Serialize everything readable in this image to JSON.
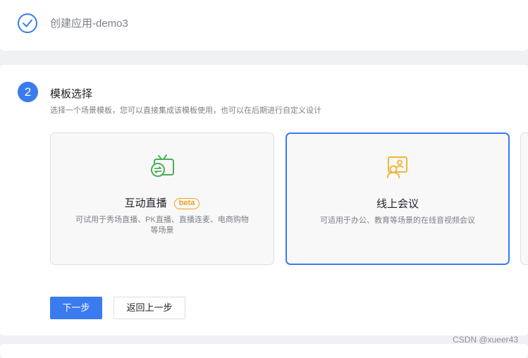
{
  "step1": {
    "status": "completed",
    "title": "创建应用-demo3",
    "icon": "check-icon"
  },
  "step2": {
    "number": "2",
    "title": "模板选择",
    "description": "选择一个场景模板，您可以直接集成该模板使用，也可以在后期进行自定义设计",
    "cards": [
      {
        "id": "live",
        "icon": "tv-live-icon",
        "title": "互动直播",
        "badge": "beta",
        "description": "可试用于秀场直播、PK直播、直播连麦、电商购物等场景",
        "selected": false
      },
      {
        "id": "meeting",
        "icon": "video-meeting-icon",
        "title": "线上会议",
        "description": "可适用于办公、教育等场景的在线音视频会议",
        "selected": true
      }
    ],
    "buttons": {
      "next": "下一步",
      "back": "返回上一步"
    }
  },
  "colors": {
    "primary": "#3a7bef",
    "live_icon": "#4caf50",
    "meeting_icon": "#f0b63c",
    "badge": "#f0a020"
  },
  "watermark": "CSDN @xueer43"
}
